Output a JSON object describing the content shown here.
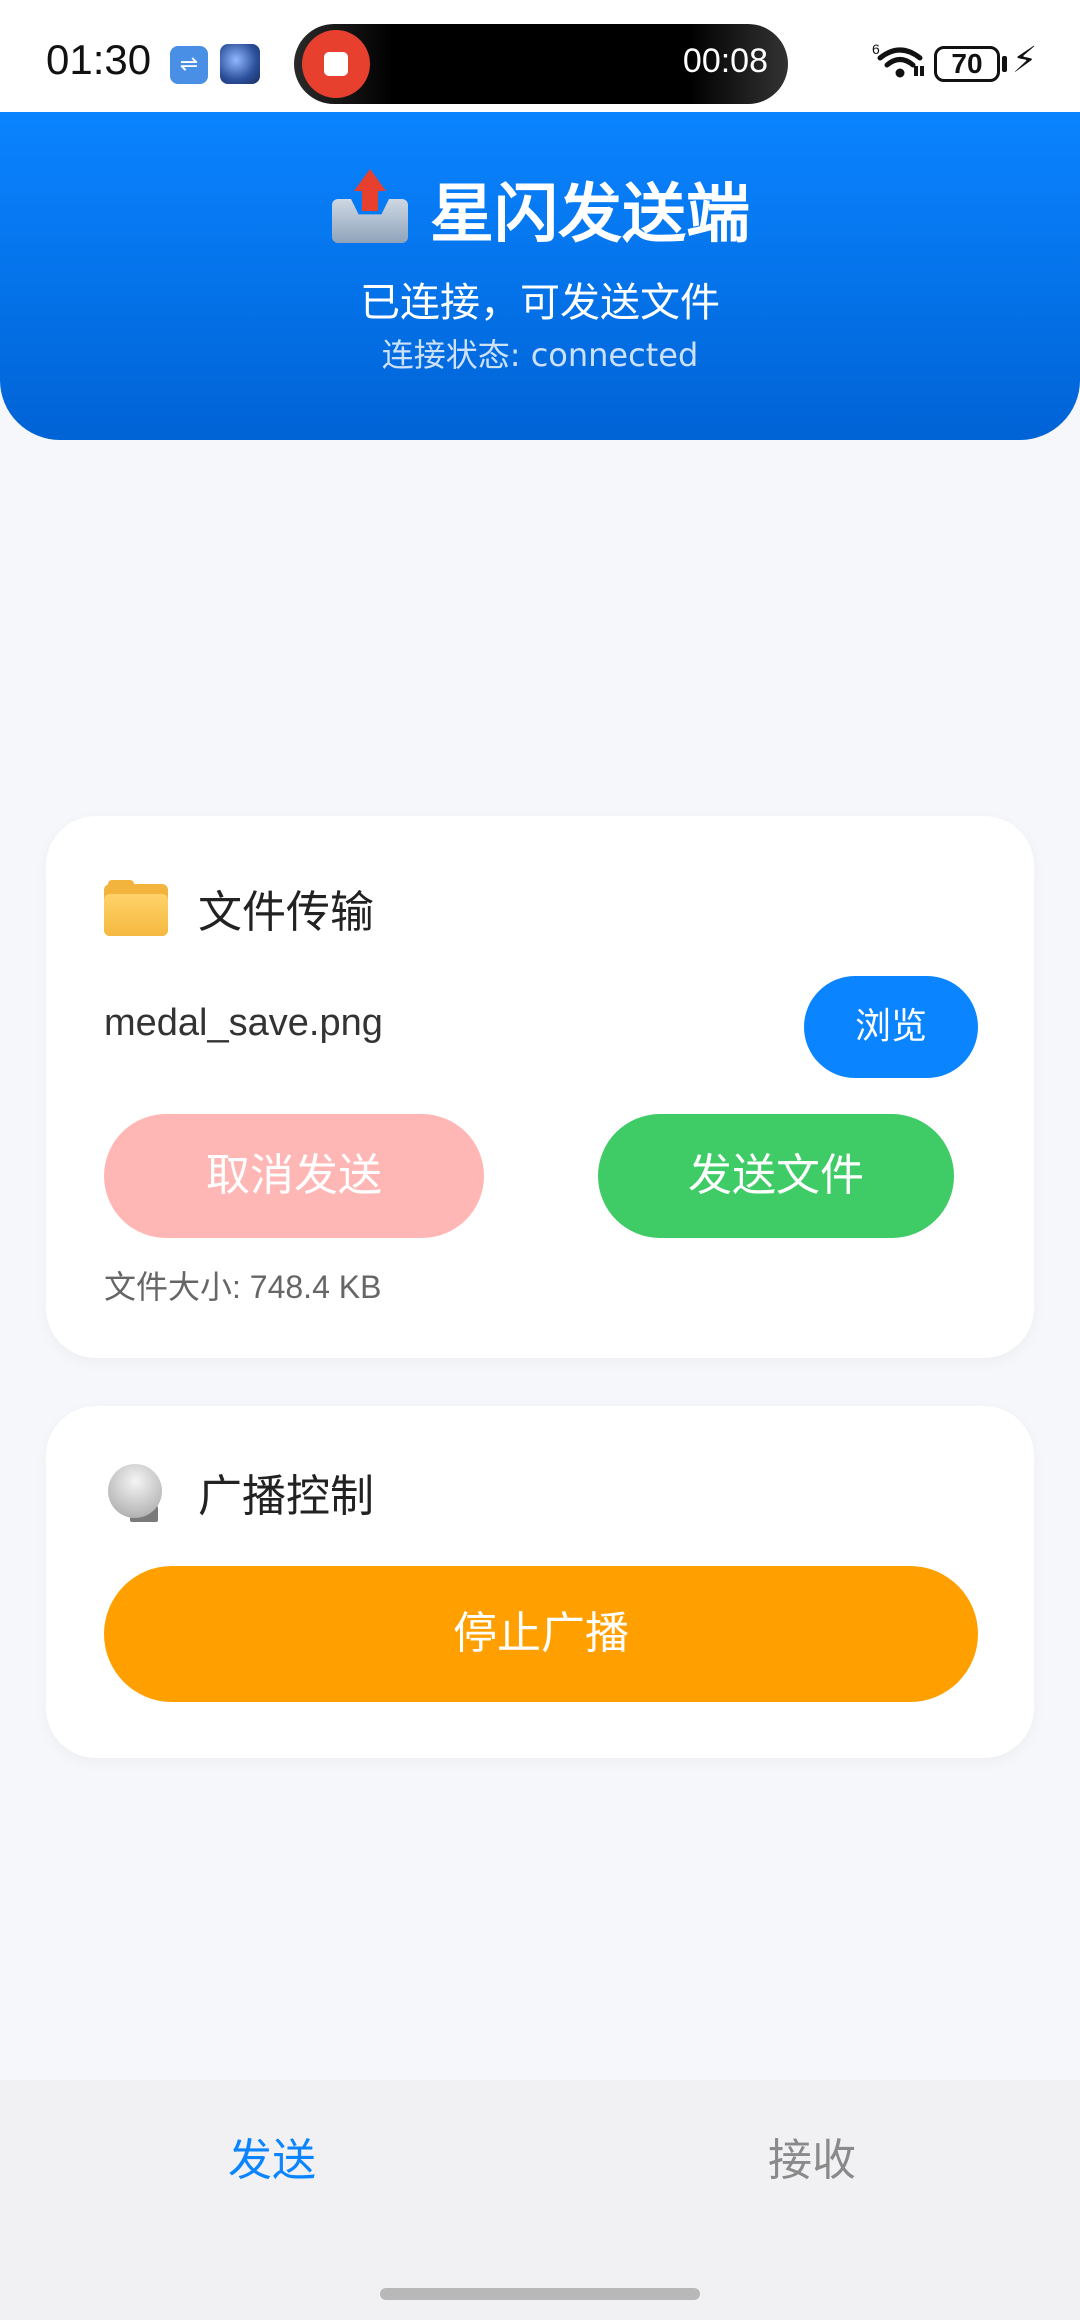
{
  "status_bar": {
    "time": "01:30",
    "recording_time": "00:08",
    "network_label": "6",
    "battery": "70",
    "icons": [
      "usb-icon",
      "globe-icon",
      "record-stop-icon",
      "wifi-icon",
      "battery-icon",
      "charging-icon"
    ]
  },
  "header": {
    "title": "星闪发送端",
    "subtitle": "已连接，可发送文件",
    "status": "连接状态: connected",
    "icon": "outbox-tray-icon",
    "colors": {
      "gradient_top": "#0a84ff",
      "gradient_bottom": "#0063d6"
    }
  },
  "transfer_card": {
    "title": "文件传输",
    "icon": "folder-icon",
    "file_name": "medal_save.png",
    "browse_label": "浏览",
    "cancel_label": "取消发送",
    "send_label": "发送文件",
    "file_size": "文件大小: 748.4 KB",
    "colors": {
      "browse": "#0a84ff",
      "cancel": "#ffb7b5",
      "send": "#3fcc66"
    }
  },
  "broadcast_card": {
    "title": "广播控制",
    "icon": "satellite-dish-icon",
    "stop_label": "停止广播",
    "colors": {
      "stop": "#ffa000"
    }
  },
  "bottom_nav": {
    "tabs": [
      {
        "label": "发送",
        "active": true
      },
      {
        "label": "接收",
        "active": false
      }
    ],
    "colors": {
      "active": "#0a84ff",
      "inactive": "#8a8a8a"
    }
  }
}
